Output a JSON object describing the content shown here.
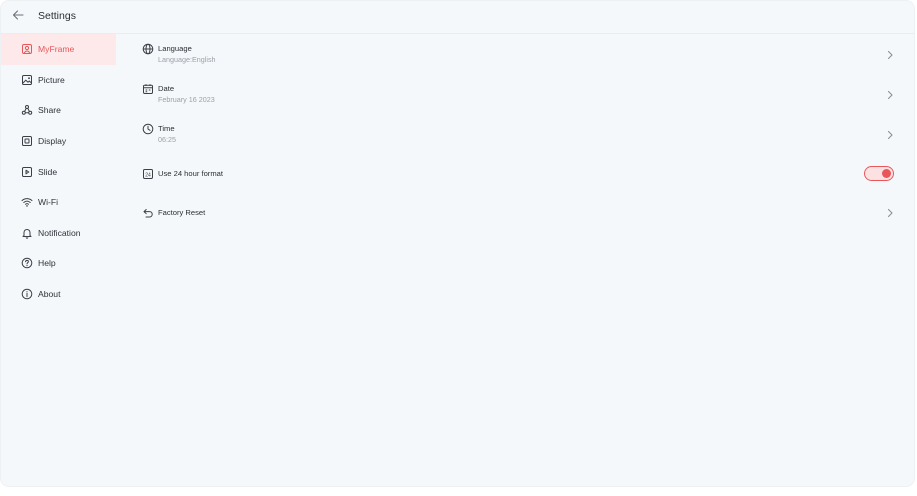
{
  "header": {
    "title": "Settings",
    "back_icon": "arrow-left-icon"
  },
  "sidebar": {
    "active_color": "#e8575a",
    "items": [
      {
        "label": "MyFrame",
        "icon": "user-portrait-icon",
        "active": true
      },
      {
        "label": "Picture",
        "icon": "image-icon",
        "active": false
      },
      {
        "label": "Share",
        "icon": "share-icon",
        "active": false
      },
      {
        "label": "Display",
        "icon": "display-icon",
        "active": false
      },
      {
        "label": "Slide",
        "icon": "slideshow-play-icon",
        "active": false
      },
      {
        "label": "Wi-Fi",
        "icon": "wifi-icon",
        "active": false
      },
      {
        "label": "Notification",
        "icon": "bell-icon",
        "active": false
      },
      {
        "label": "Help",
        "icon": "question-circle-icon",
        "active": false
      },
      {
        "label": "About",
        "icon": "info-circle-icon",
        "active": false
      }
    ]
  },
  "settings": {
    "language": {
      "label": "Language",
      "value": "Language:English",
      "icon": "globe-icon"
    },
    "date": {
      "label": "Date",
      "value": "February 16 2023",
      "icon": "calendar-icon"
    },
    "time": {
      "label": "Time",
      "value": "06:25",
      "icon": "clock-icon"
    },
    "hour_format": {
      "label": "Use 24 hour format",
      "icon": "24h-icon",
      "enabled": true
    },
    "factory_reset": {
      "label": "Factory Reset",
      "icon": "undo-icon"
    }
  }
}
